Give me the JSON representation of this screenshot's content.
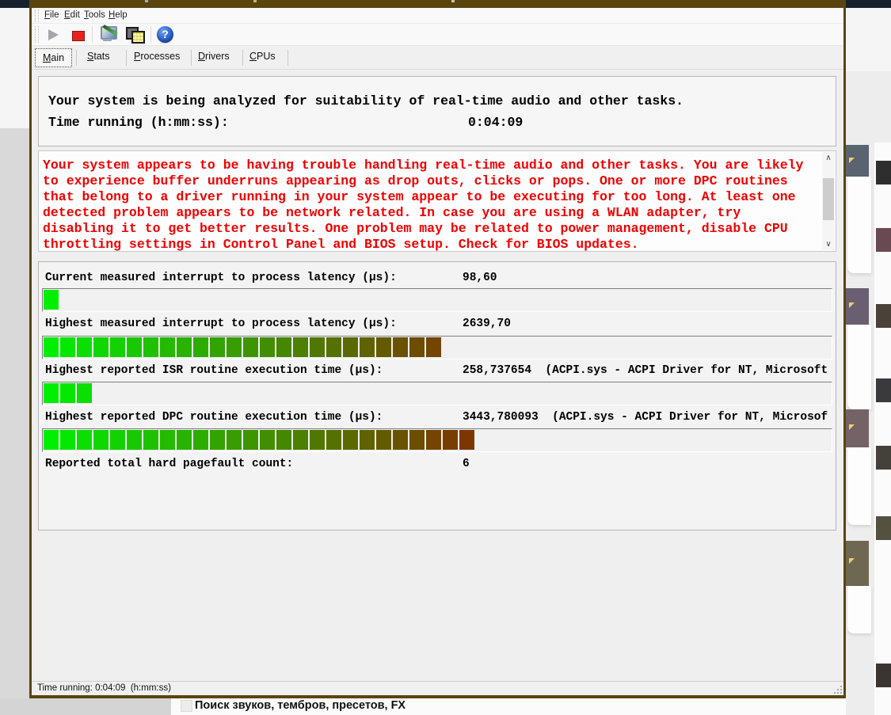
{
  "window_chrome": {
    "menu": [
      {
        "label": "File",
        "accel": 0
      },
      {
        "label": "Edit",
        "accel": 0
      },
      {
        "label": "Tools",
        "accel": 0
      },
      {
        "label": "Help",
        "accel": 0
      }
    ],
    "toolbar": {
      "icons": [
        "play-icon",
        "stop-icon",
        "options-icon",
        "copy-report-icon",
        "help-icon"
      ],
      "help_glyph": "?"
    },
    "tabs": [
      {
        "label": "Main",
        "accel": 0
      },
      {
        "label": "Stats",
        "accel": 0
      },
      {
        "label": "Processes",
        "accel": 0
      },
      {
        "label": "Drivers",
        "accel": 0
      },
      {
        "label": "CPUs",
        "accel": 0
      }
    ],
    "selected_tab": "Main",
    "status_text": "Time running: 0:04:09  (h:mm:ss)",
    "chrome_color": "#5a450f"
  },
  "main": {
    "intro_line": "Your system is being analyzed for suitability of real-time audio and other tasks.",
    "time_label": "Time running (h:mm:ss):",
    "time_value": "0:04:09",
    "warning_lines": [
      "Your system appears to be having trouble handling real-time audio and other tasks. You are likely",
      "to experience buffer underruns appearing as drop outs, clicks or pops. One or more DPC routines",
      "that belong to a driver running in your system appear to be executing for too long. At least one",
      "detected problem appears to be network related. In case you are using a WLAN adapter, try",
      "disabling it to get better results. One problem may be related to power management, disable CPU",
      "throttling settings in Control Panel and BIOS setup. Check for BIOS updates."
    ],
    "warning_color": "#ef0000",
    "scrollbar": {
      "up_glyph": "∧",
      "down_glyph": "∨"
    },
    "meters": [
      {
        "label": "Current measured interrupt to process latency (µs):",
        "value_display": "98,60",
        "segments": 1
      },
      {
        "label": "Highest measured interrupt to process latency (µs):",
        "value_display": "2639,70",
        "segments": 24
      },
      {
        "label": "Highest reported ISR routine execution time (µs):",
        "value_display": "258,737654  (ACPI.sys - ACPI Driver for NT, Microsoft",
        "segments": 3
      },
      {
        "label": "Highest reported DPC routine execution time (µs):",
        "value_display": "3443,780093  (ACPI.sys - ACPI Driver for NT, Microsof",
        "segments": 26
      },
      {
        "label": "Reported total hard pagefault count:",
        "value_display": "6",
        "segments": 0
      }
    ],
    "gradient": {
      "start": "#00ee00",
      "end": "#7d3600",
      "max_segments": 26
    }
  },
  "background": {
    "bottom_text": "Поиск звуков, тембров, пресетов, FX"
  }
}
